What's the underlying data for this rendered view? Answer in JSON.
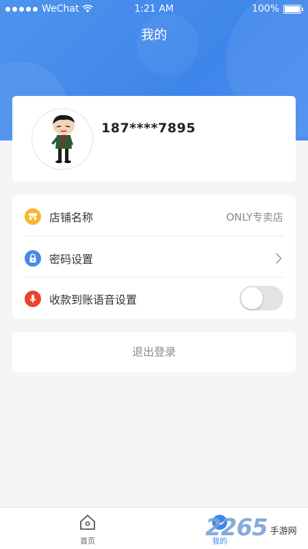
{
  "status_bar": {
    "carrier": "WeChat",
    "time": "1:21 AM",
    "battery": "100%"
  },
  "header": {
    "title": "我的"
  },
  "profile": {
    "phone": "187****7895"
  },
  "settings": {
    "items": [
      {
        "label": "店铺名称",
        "value": "ONLY专卖店",
        "icon": "store-icon",
        "icon_color": "#f5b82e"
      },
      {
        "label": "密码设置",
        "icon": "lock-icon",
        "icon_color": "#4a88e8"
      },
      {
        "label": "收款到账语音设置",
        "icon": "microphone-icon",
        "icon_color": "#e8452c",
        "toggle_on": false
      }
    ]
  },
  "logout": {
    "label": "退出登录"
  },
  "tabbar": {
    "items": [
      {
        "label": "首页",
        "icon": "home-icon",
        "active": false
      },
      {
        "label": "我的",
        "icon": "profile-icon",
        "active": true
      }
    ]
  },
  "watermark": {
    "number": "2265",
    "text": "手游网"
  },
  "colors": {
    "accent": "#3f86ea",
    "background": "#f4f5f7",
    "card": "#ffffff"
  }
}
